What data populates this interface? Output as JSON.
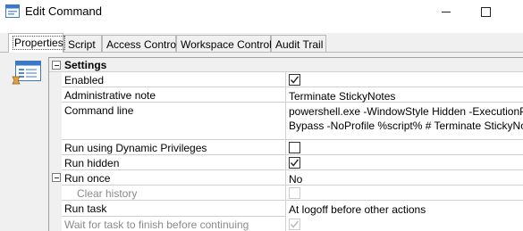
{
  "window": {
    "title": "Edit Command",
    "icon": "app-window-icon",
    "controls": [
      "minimize",
      "maximize"
    ]
  },
  "tabs": [
    {
      "label": "Properties",
      "active": true
    },
    {
      "label": "Script",
      "active": false
    },
    {
      "label": "Access Control",
      "active": false
    },
    {
      "label": "Workspace Control",
      "active": false
    },
    {
      "label": "Audit Trail",
      "active": false
    }
  ],
  "sidebar": {
    "icon": "properties-window-icon"
  },
  "grid": {
    "section": "Settings",
    "rows": [
      {
        "name": "Enabled",
        "type": "checkbox",
        "checked": true
      },
      {
        "name": "Administrative note",
        "type": "text",
        "value": "Terminate StickyNotes"
      },
      {
        "name": "Command line",
        "type": "text",
        "value_line1": "powershell.exe -WindowStyle Hidden -ExecutionPolicy",
        "value_line2": "Bypass -NoProfile %script% # Terminate StickyNotes"
      },
      {
        "name": "Run using Dynamic Privileges",
        "type": "checkbox",
        "checked": false
      },
      {
        "name": "Run hidden",
        "type": "checkbox",
        "checked": true
      },
      {
        "name": "Run once",
        "type": "text",
        "value": "No",
        "expandable": true
      },
      {
        "name": "Clear history",
        "type": "checkbox",
        "checked": false,
        "disabled": true
      },
      {
        "name": "Run task",
        "type": "text",
        "value": "At logoff before other actions",
        "highlight_color": "#ffff5c"
      },
      {
        "name": "Wait for task to finish before continuing",
        "type": "checkbox",
        "checked": true,
        "disabled": true
      }
    ]
  }
}
